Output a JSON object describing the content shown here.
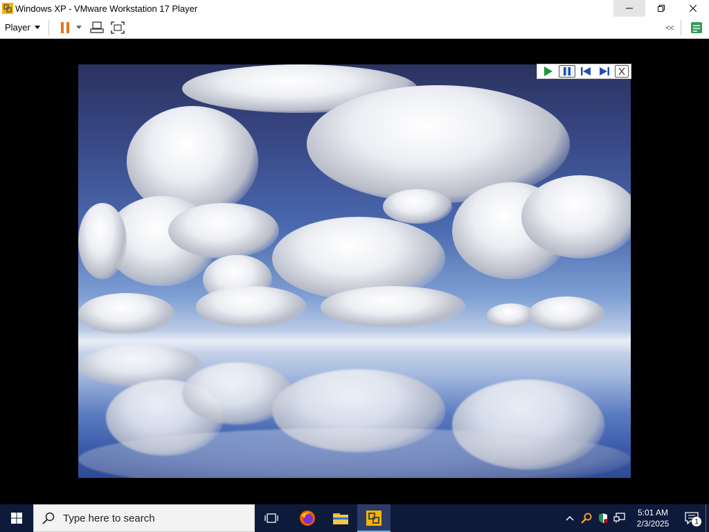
{
  "window": {
    "title": "Windows XP - VMware Workstation 17 Player"
  },
  "toolbar": {
    "player_label": "Player",
    "collapse_label": "<<"
  },
  "slideshow": {
    "controls": [
      "play-icon",
      "pause-icon",
      "previous-icon",
      "next-icon",
      "close-icon"
    ]
  },
  "taskbar": {
    "search_placeholder": "Type here to search",
    "apps": [
      "task-view-icon",
      "firefox-icon",
      "file-explorer-icon",
      "vmware-player-icon"
    ],
    "clock": {
      "time": "5:01 AM",
      "date": "2/3/2025"
    },
    "notification_count": "1"
  },
  "colors": {
    "taskbar_bg": "#0e1a3a",
    "pause_accent": "#e8731a",
    "play_green": "#1a9a3a",
    "nav_blue": "#1f4fb4"
  }
}
